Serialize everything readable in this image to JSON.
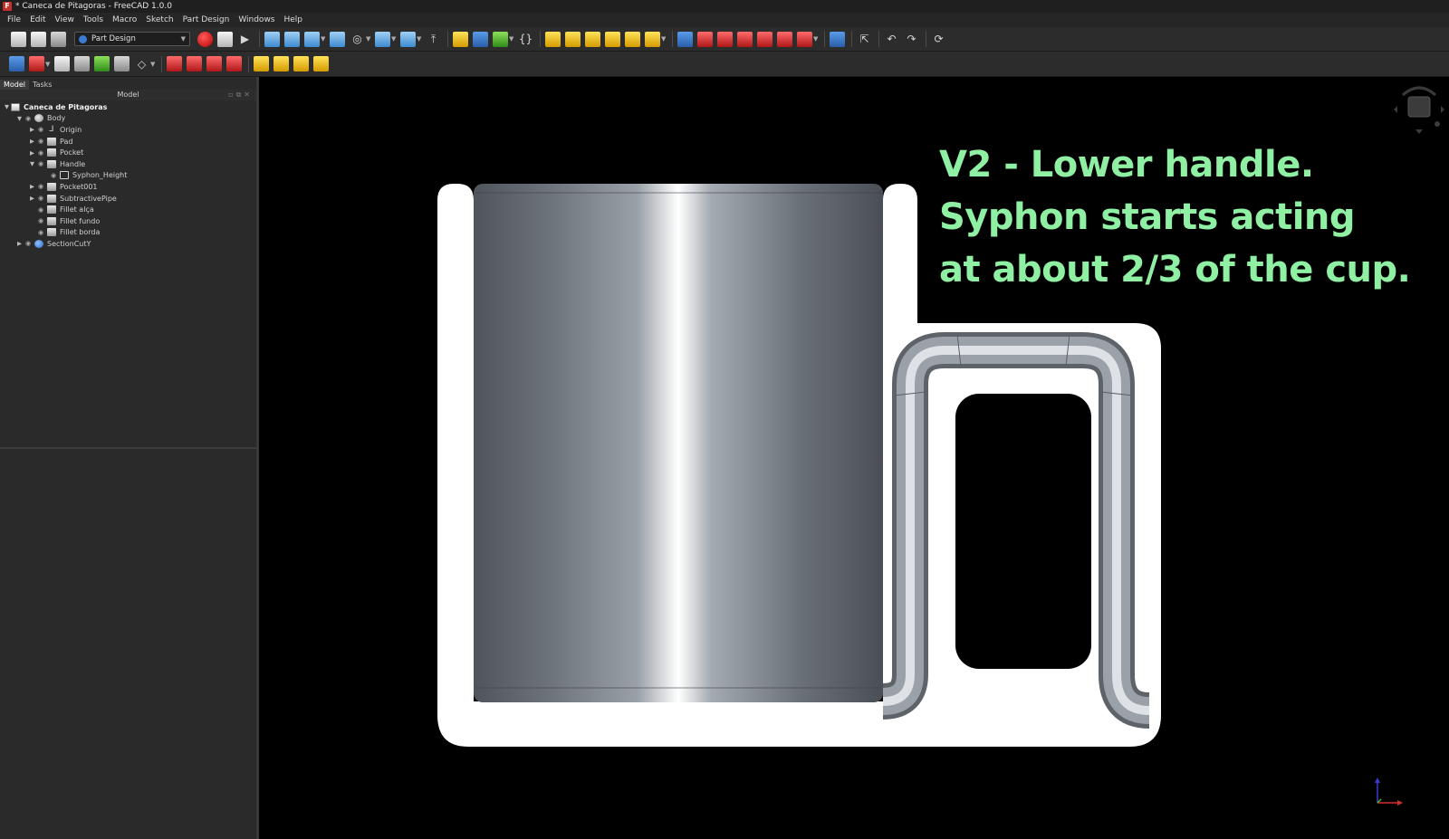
{
  "window": {
    "title": "* Caneca de Pitagoras - FreeCAD 1.0.0"
  },
  "menu": [
    "File",
    "Edit",
    "View",
    "Tools",
    "Macro",
    "Sketch",
    "Part Design",
    "Windows",
    "Help"
  ],
  "toolbar": {
    "workbench": "Part Design",
    "braces_label": "{}"
  },
  "panel": {
    "tabs": [
      "Model",
      "Tasks"
    ],
    "header": "Model"
  },
  "tree": [
    {
      "label": "Caneca de Pitagoras",
      "icon": "document-icon",
      "depth": 0,
      "expander": "expanded",
      "bold": true
    },
    {
      "label": "Body",
      "icon": "body-icon",
      "depth": 1,
      "expander": "expanded"
    },
    {
      "label": "Origin",
      "icon": "origin-icon",
      "depth": 2,
      "expander": "collapsed"
    },
    {
      "label": "Pad",
      "icon": "pad-icon",
      "depth": 2,
      "expander": "collapsed"
    },
    {
      "label": "Pocket",
      "icon": "pocket-icon",
      "depth": 2,
      "expander": "collapsed"
    },
    {
      "label": "Handle",
      "icon": "pad-icon",
      "depth": 2,
      "expander": "expanded"
    },
    {
      "label": "Syphon_Height",
      "icon": "sketch-icon",
      "depth": 3,
      "expander": "none"
    },
    {
      "label": "Pocket001",
      "icon": "pocket-icon",
      "depth": 2,
      "expander": "collapsed"
    },
    {
      "label": "SubtractivePipe",
      "icon": "pipe-icon",
      "depth": 2,
      "expander": "collapsed"
    },
    {
      "label": "Fillet alça",
      "icon": "fillet-icon",
      "depth": 2,
      "expander": "none"
    },
    {
      "label": "Fillet fundo",
      "icon": "fillet-icon",
      "depth": 2,
      "expander": "none"
    },
    {
      "label": "Fillet borda",
      "icon": "fillet-icon",
      "depth": 2,
      "expander": "none"
    },
    {
      "label": "SectionCutY",
      "icon": "section-cut-icon",
      "depth": 1,
      "expander": "collapsed"
    }
  ],
  "annotation": {
    "line1": "V2 - Lower handle.",
    "line2": "Syphon starts acting",
    "line3": "at about 2/3 of the cup.",
    "color": "#8ff0a4"
  },
  "colors": {
    "background": "#000000",
    "section_face": "#ffffff",
    "metal_dark": "#5a6068",
    "metal_highlight": "#ffffff"
  }
}
